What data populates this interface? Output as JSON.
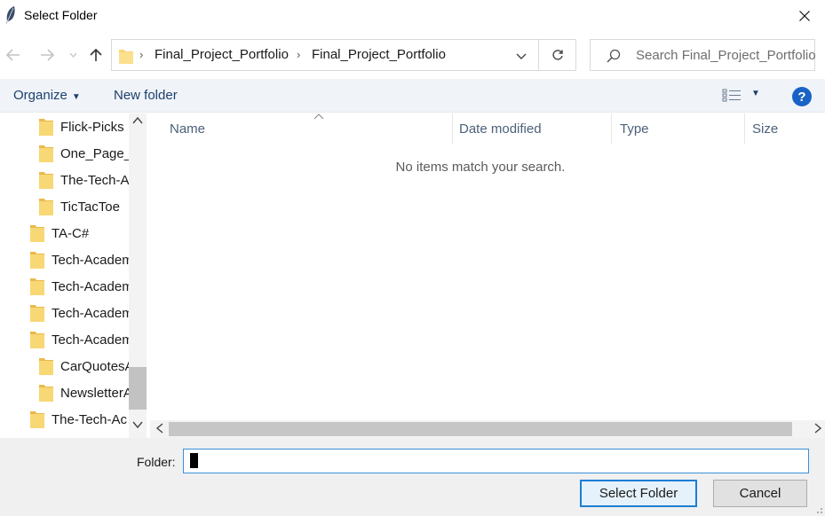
{
  "window": {
    "title": "Select Folder",
    "close_icon": "close-icon"
  },
  "nav": {
    "back_icon": "arrow-left-icon",
    "forward_icon": "arrow-right-icon",
    "recent_icon": "chevron-down-icon",
    "up_icon": "arrow-up-icon"
  },
  "address": {
    "crumbs": [
      "Final_Project_Portfolio",
      "Final_Project_Portfolio"
    ],
    "separator": "›"
  },
  "search": {
    "placeholder": "Search Final_Project_Portfolio"
  },
  "toolbar": {
    "organize_label": "Organize",
    "new_folder_label": "New folder",
    "help_label": "?"
  },
  "tree": {
    "items": [
      {
        "label": "Flick-Picks",
        "indent": 1
      },
      {
        "label": "One_Page_W",
        "indent": 1
      },
      {
        "label": "The-Tech-A",
        "indent": 1
      },
      {
        "label": "TicTacToe",
        "indent": 1
      },
      {
        "label": "TA-C#",
        "indent": 0
      },
      {
        "label": "Tech-Academ",
        "indent": 0
      },
      {
        "label": "Tech-Academ",
        "indent": 0
      },
      {
        "label": "Tech-Academ",
        "indent": 0
      },
      {
        "label": "Tech-Academ",
        "indent": 0
      },
      {
        "label": "CarQuotesA",
        "indent": 1
      },
      {
        "label": "NewsletterA",
        "indent": 1
      },
      {
        "label": "The-Tech-Ac",
        "indent": 0
      }
    ]
  },
  "columns": {
    "name": "Name",
    "date": "Date modified",
    "type": "Type",
    "size": "Size"
  },
  "content": {
    "empty_message": "No items match your search."
  },
  "footer": {
    "folder_label": "Folder:",
    "folder_value": "",
    "select_label": "Select Folder",
    "cancel_label": "Cancel"
  },
  "colors": {
    "accent": "#1a7fd4",
    "folder": "#f8d775",
    "help": "#1a63c6"
  }
}
